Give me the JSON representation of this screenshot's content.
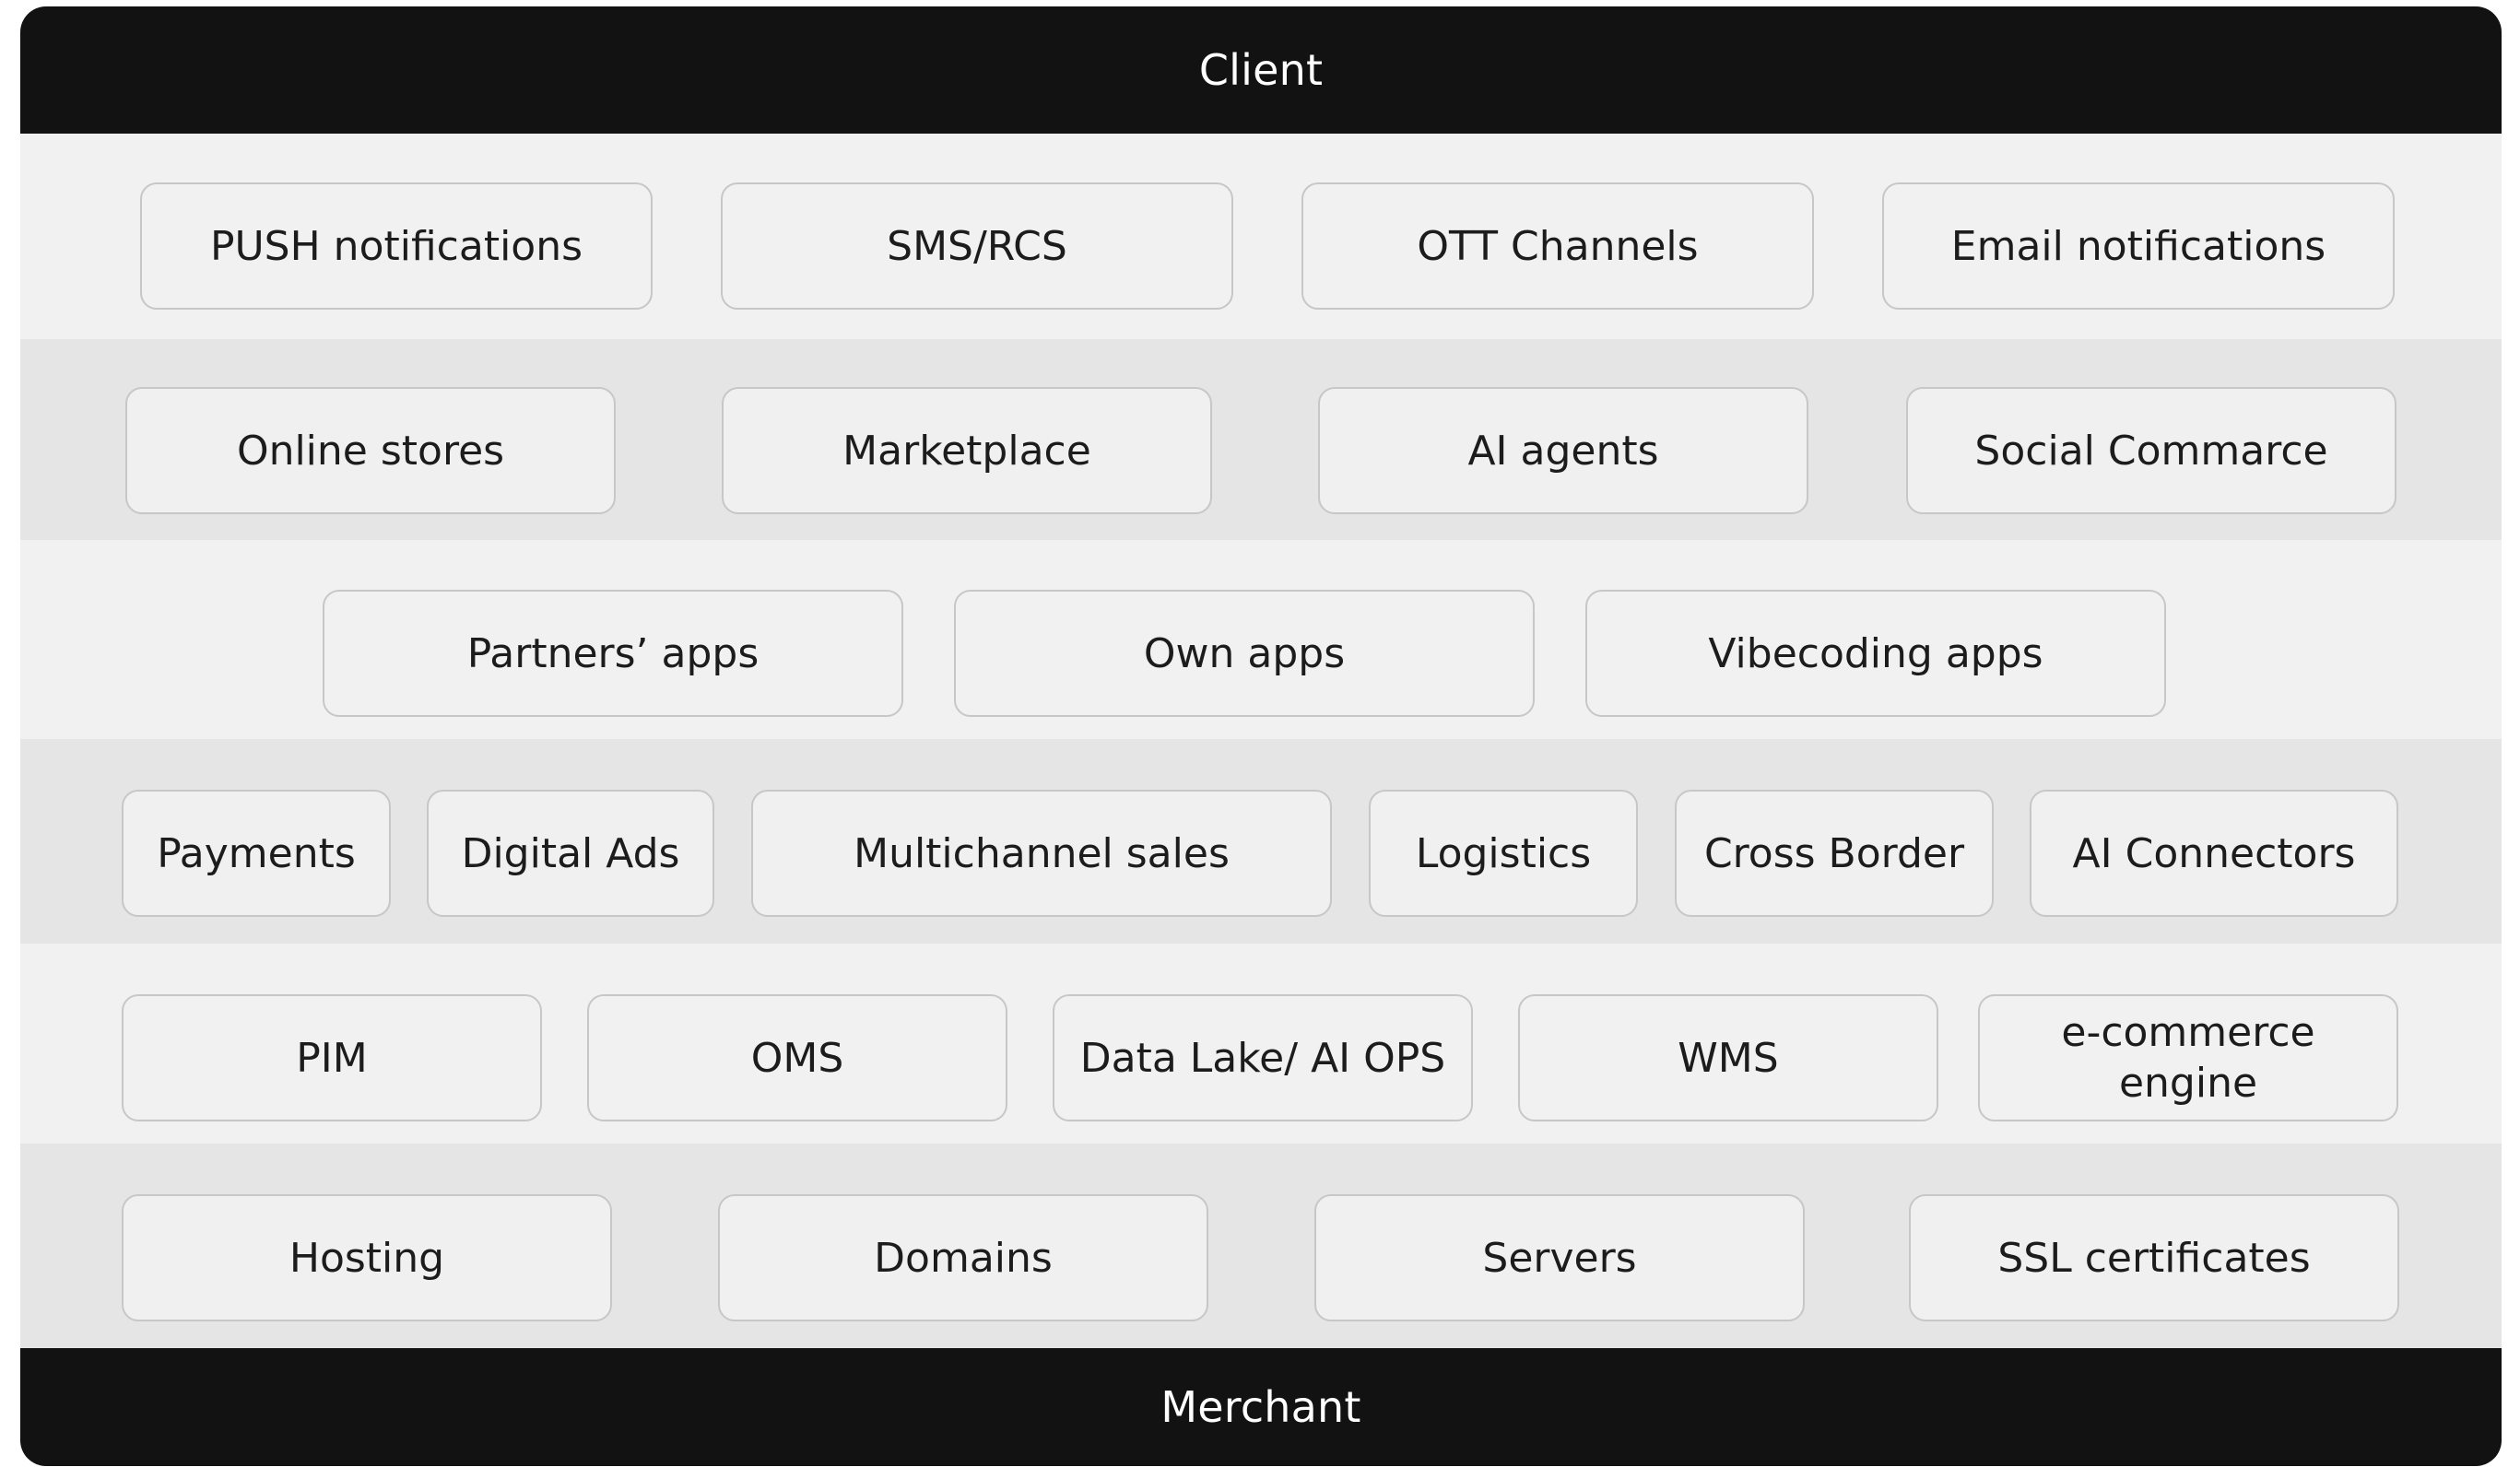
{
  "top_bar": {
    "label": "Client"
  },
  "bottom_bar": {
    "label": "Merchant"
  },
  "rows": [
    {
      "items": [
        "PUSH notifications",
        "SMS/RCS",
        "OTT Channels",
        "Email notifications"
      ]
    },
    {
      "items": [
        "Online stores",
        "Marketplace",
        "AI agents",
        "Social Commarce"
      ]
    },
    {
      "items": [
        "Partners’ apps",
        "Own apps",
        "Vibecoding apps"
      ]
    },
    {
      "items": [
        "Payments",
        "Digital Ads",
        "Multichannel sales",
        "Logistics",
        "Cross Border",
        "AI Connectors"
      ]
    },
    {
      "items": [
        "PIM",
        "OMS",
        "Data Lake/ AI OPS",
        "WMS",
        "e-commerce engine"
      ]
    },
    {
      "items": [
        "Hosting",
        "Domains",
        "Servers",
        "SSL certificates"
      ]
    }
  ],
  "colors": {
    "bar": "#121212",
    "band_light": "#f1f1f1",
    "band_dark": "#e5e5e5",
    "box_border": "#c7c7c7"
  }
}
